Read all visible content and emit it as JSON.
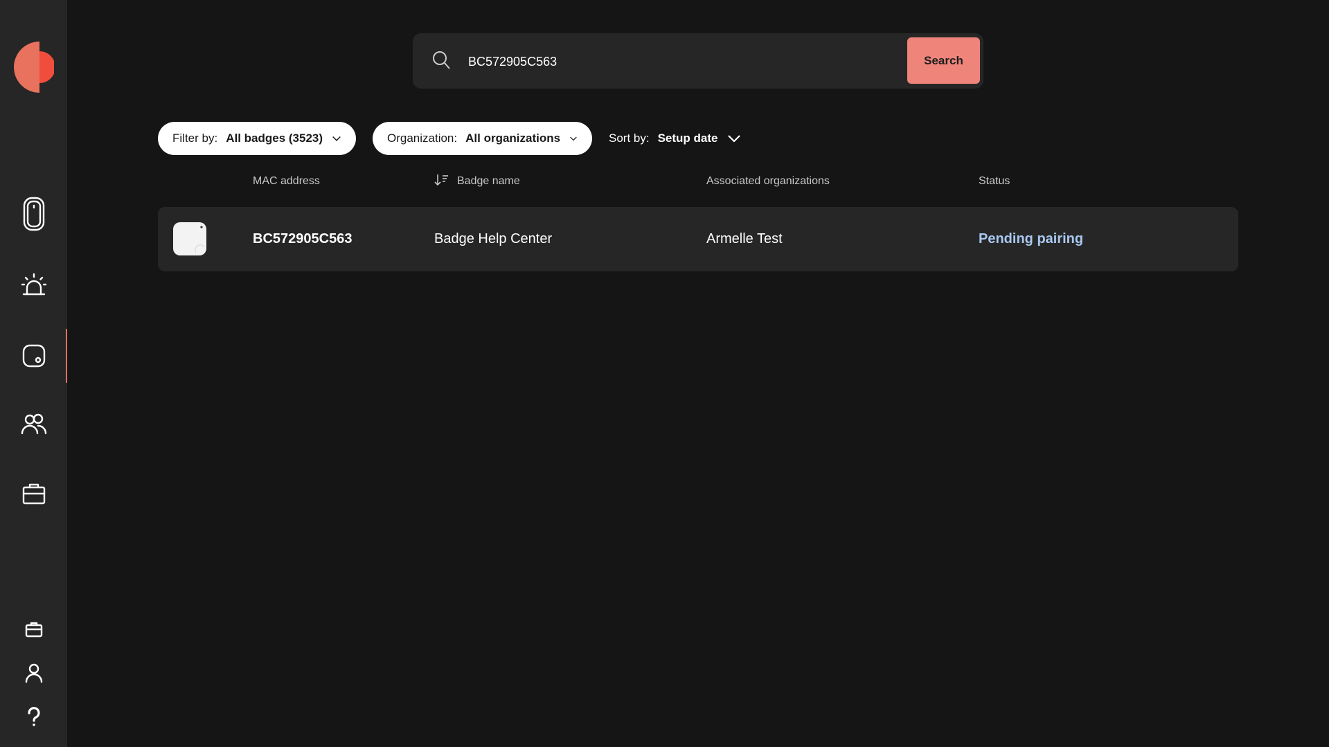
{
  "search": {
    "value": "BC572905C563",
    "button_label": "Search"
  },
  "filters": {
    "filter_label": "Filter by:",
    "filter_value": "All badges (3523)",
    "org_label": "Organization:",
    "org_value": "All organizations",
    "sort_label": "Sort by:",
    "sort_value": "Setup date"
  },
  "table": {
    "columns": [
      "MAC address",
      "Badge name",
      "Associated organizations",
      "Status"
    ],
    "rows": [
      {
        "mac": "BC572905C563",
        "badge_name": "Badge Help Center",
        "organization": "Armelle Test",
        "status": "Pending pairing"
      }
    ]
  },
  "sidebar": {
    "items": [
      "badge-device-icon",
      "alarm-icon",
      "badge-square-icon",
      "users-icon",
      "briefcase-icon"
    ],
    "bottom_items": [
      "small-briefcase-icon",
      "user-icon",
      "help-icon"
    ],
    "active_item": "badge-square-icon"
  },
  "colors": {
    "accent": "#ef857a",
    "logo_orange": "#e5705e",
    "logo_red": "#f04e3c",
    "status_pending": "#a9c8f0",
    "background": "#151515",
    "panel": "#262626"
  }
}
